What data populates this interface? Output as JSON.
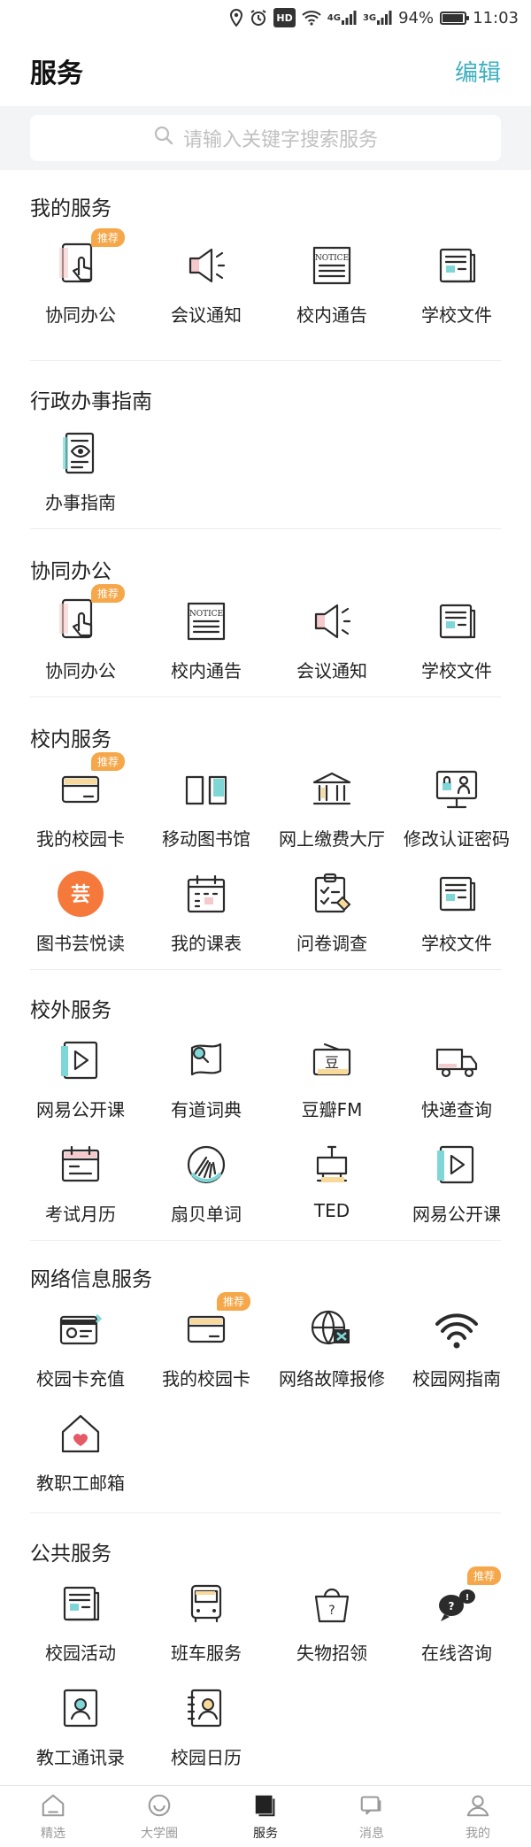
{
  "status": {
    "battery": "94%",
    "time": "11:03",
    "hd": "HD",
    "net1": "4G",
    "net2": "3G",
    "battery_level": 0.94
  },
  "header": {
    "title": "服务",
    "edit_label": "编辑"
  },
  "search": {
    "placeholder": "请输入关键字搜索服务"
  },
  "sections": [
    {
      "title": "我的服务",
      "items": [
        {
          "label": "协同办公",
          "icon": "tablet-touch-icon",
          "badge": "推荐"
        },
        {
          "label": "会议通知",
          "icon": "megaphone-icon"
        },
        {
          "label": "校内通告",
          "icon": "notice-icon"
        },
        {
          "label": "学校文件",
          "icon": "document-icon"
        }
      ]
    },
    {
      "title": "行政办事指南",
      "items": [
        {
          "label": "办事指南",
          "icon": "guide-eye-icon"
        }
      ]
    },
    {
      "title": "协同办公",
      "items": [
        {
          "label": "协同办公",
          "icon": "tablet-touch-icon",
          "badge": "推荐"
        },
        {
          "label": "校内通告",
          "icon": "notice-icon"
        },
        {
          "label": "会议通知",
          "icon": "megaphone-icon"
        },
        {
          "label": "学校文件",
          "icon": "document-icon"
        }
      ]
    },
    {
      "title": "校内服务",
      "items": [
        {
          "label": "我的校园卡",
          "icon": "campus-card-icon",
          "badge": "推荐"
        },
        {
          "label": "移动图书馆",
          "icon": "book-icon"
        },
        {
          "label": "网上缴费大厅",
          "icon": "bank-icon"
        },
        {
          "label": "修改认证密码",
          "icon": "monitor-lock-icon"
        },
        {
          "label": "图书芸悦读",
          "icon": "yun-reading-icon",
          "glyph": "芸"
        },
        {
          "label": "我的课表",
          "icon": "calendar-icon"
        },
        {
          "label": "问卷调查",
          "icon": "clipboard-icon"
        },
        {
          "label": "学校文件",
          "icon": "document-icon"
        }
      ]
    },
    {
      "title": "校外服务",
      "items": [
        {
          "label": "网易公开课",
          "icon": "play-icon"
        },
        {
          "label": "有道词典",
          "icon": "dictionary-icon"
        },
        {
          "label": "豆瓣FM",
          "icon": "radio-icon",
          "glyph": "豆"
        },
        {
          "label": "快递查询",
          "icon": "truck-icon"
        },
        {
          "label": "考试月历",
          "icon": "exam-calendar-icon"
        },
        {
          "label": "扇贝单词",
          "icon": "shell-icon"
        },
        {
          "label": "TED",
          "icon": "podium-icon"
        },
        {
          "label": "网易公开课",
          "icon": "play-icon"
        }
      ]
    },
    {
      "title": "网络信息服务",
      "items": [
        {
          "label": "校园卡充值",
          "icon": "card-recharge-icon"
        },
        {
          "label": "我的校园卡",
          "icon": "campus-card-icon",
          "badge": "推荐"
        },
        {
          "label": "网络故障报修",
          "icon": "globe-repair-icon"
        },
        {
          "label": "校园网指南",
          "icon": "wifi-icon"
        },
        {
          "label": "教职工邮箱",
          "icon": "mail-house-icon"
        }
      ]
    },
    {
      "title": "公共服务",
      "items": [
        {
          "label": "校园活动",
          "icon": "document-icon"
        },
        {
          "label": "班车服务",
          "icon": "bus-icon"
        },
        {
          "label": "失物招领",
          "icon": "lost-bag-icon"
        },
        {
          "label": "在线咨询",
          "icon": "chat-icon",
          "badge": "推荐"
        },
        {
          "label": "教工通讯录",
          "icon": "contacts-icon"
        },
        {
          "label": "校园日历",
          "icon": "address-book-icon"
        }
      ]
    }
  ],
  "tabs": [
    {
      "label": "精选",
      "icon": "home-icon"
    },
    {
      "label": "大学圈",
      "icon": "smile-icon"
    },
    {
      "label": "服务",
      "icon": "service-icon",
      "active": true
    },
    {
      "label": "消息",
      "icon": "message-icon"
    },
    {
      "label": "我的",
      "icon": "profile-icon"
    }
  ],
  "colors": {
    "accent": "#3fb0c0",
    "badge": "#f5a74a",
    "icon_stroke": "#2b2b2b",
    "icon_pink": "#f6c9cc",
    "icon_teal": "#7fd6d6",
    "icon_yellow": "#f8d99a",
    "orange": "#f5793b"
  }
}
